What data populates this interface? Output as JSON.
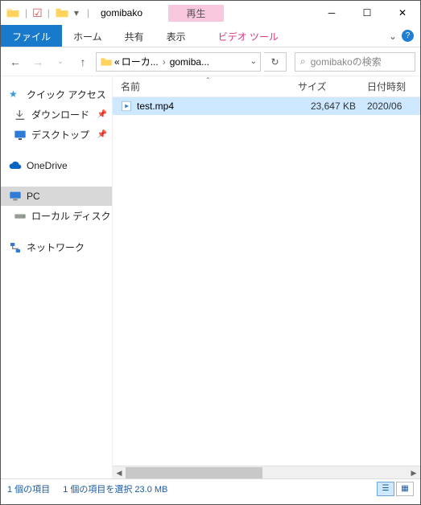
{
  "window": {
    "title": "gomibako",
    "context_tab": "再生",
    "context_sub": "ビデオ ツール"
  },
  "ribbon": {
    "file": "ファイル",
    "home": "ホーム",
    "share": "共有",
    "view": "表示"
  },
  "address": {
    "prefix": "«",
    "part1": "ローカ...",
    "part2": "gomiba..."
  },
  "search": {
    "placeholder": "gomibakoの検索"
  },
  "sidebar": {
    "quick": "クイック アクセス",
    "downloads": "ダウンロード",
    "desktop": "デスクトップ",
    "onedrive": "OneDrive",
    "pc": "PC",
    "local": "ローカル ディスク (E",
    "network": "ネットワーク"
  },
  "columns": {
    "name": "名前",
    "size": "サイズ",
    "date": "日付時刻"
  },
  "files": [
    {
      "name": "test.mp4",
      "size": "23,647 KB",
      "date": "2020/06"
    }
  ],
  "status": {
    "count": "1 個の項目",
    "selected": "1 個の項目を選択 23.0 MB"
  }
}
